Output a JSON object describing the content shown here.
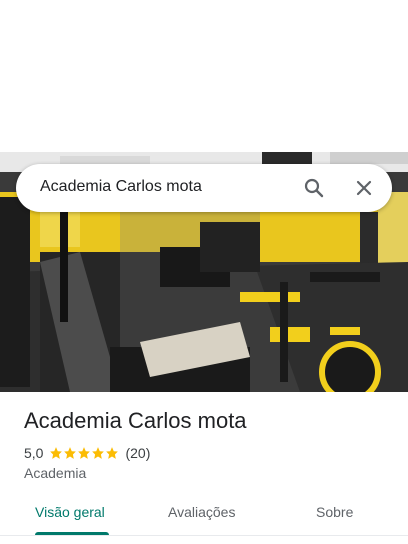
{
  "search": {
    "query": "Academia Carlos mota"
  },
  "icons": {
    "search": "search-icon",
    "close": "close-icon",
    "star": "star-icon"
  },
  "place": {
    "name": "Academia Carlos mota",
    "rating": "5,0",
    "stars": 5,
    "reviews_count": "(20)",
    "category": "Academia"
  },
  "tabs": [
    {
      "label": "Visão geral",
      "active": true
    },
    {
      "label": "Avaliações",
      "active": false
    },
    {
      "label": "Sobre",
      "active": false
    }
  ],
  "colors": {
    "accent": "#00796b",
    "star": "#fbbc04",
    "gym_yellow": "#f2cf1c"
  }
}
